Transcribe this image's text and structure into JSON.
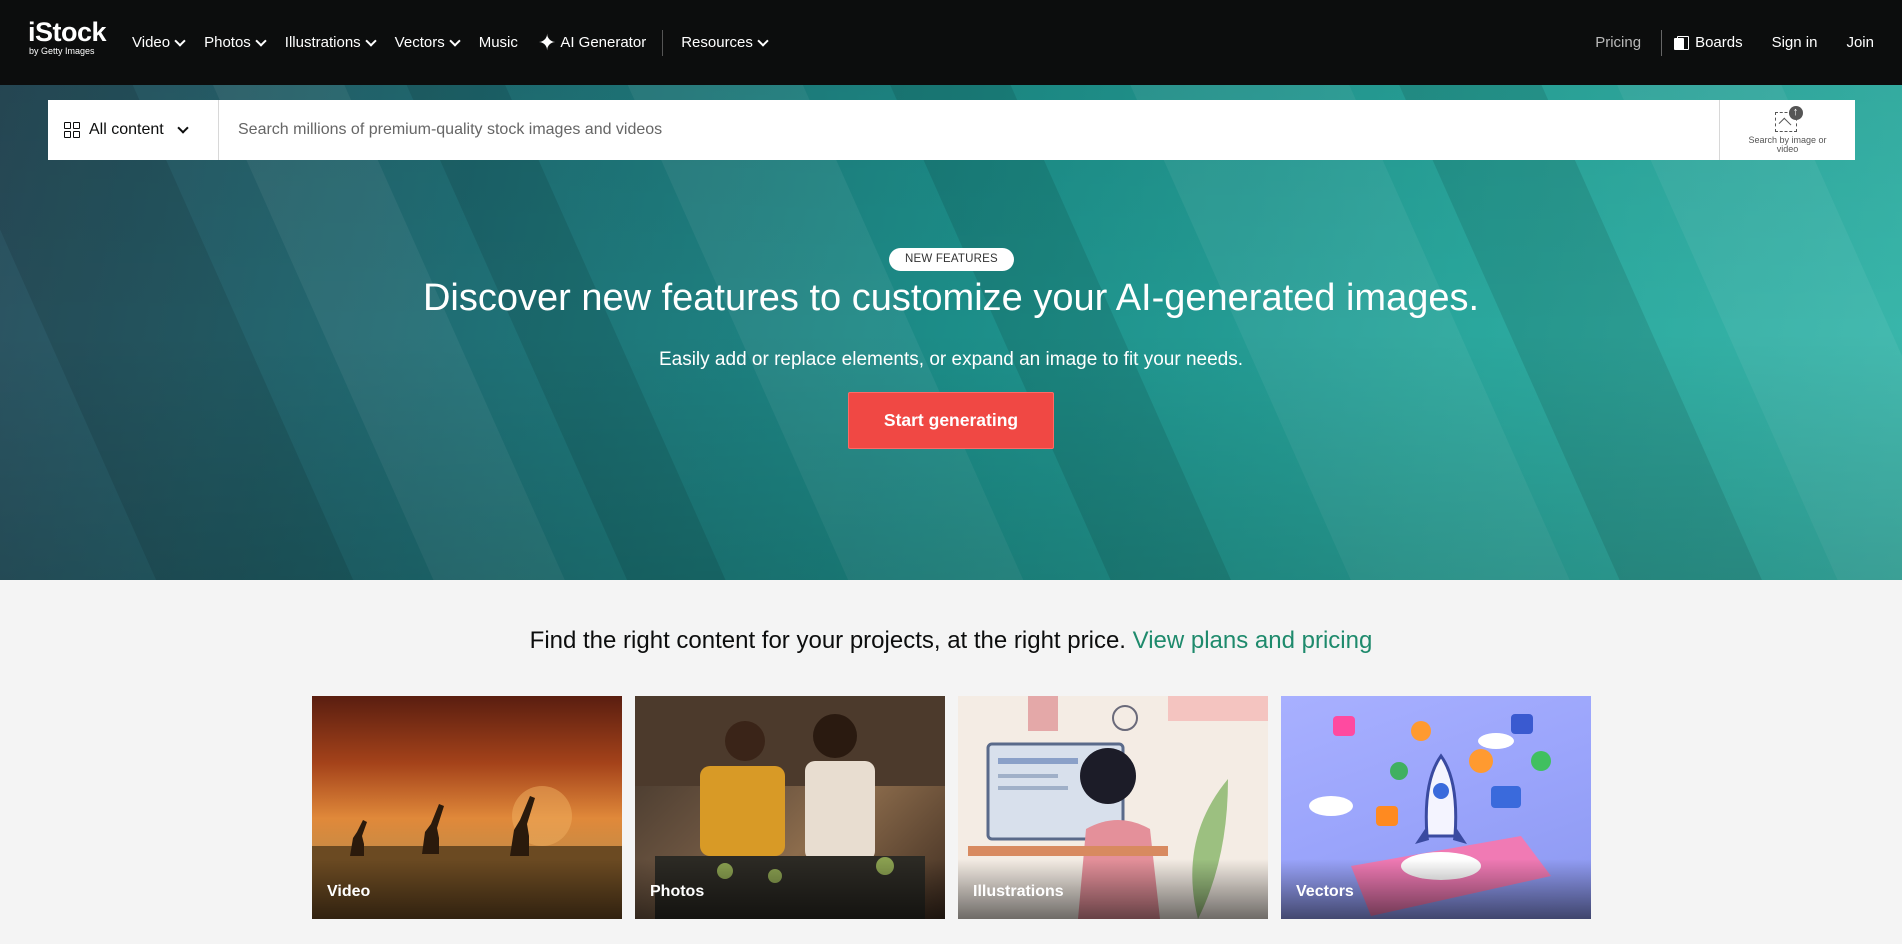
{
  "logo": {
    "name": "iStock",
    "tagline": "by Getty Images"
  },
  "nav": {
    "left_items": [
      {
        "label": "Video",
        "has_dropdown": true
      },
      {
        "label": "Photos",
        "has_dropdown": true
      },
      {
        "label": "Illustrations",
        "has_dropdown": true
      },
      {
        "label": "Vectors",
        "has_dropdown": true
      },
      {
        "label": "Music",
        "has_dropdown": false
      },
      {
        "label": "AI Generator",
        "icon": "sparkle-icon"
      },
      {
        "label": "Resources",
        "has_dropdown": true
      }
    ],
    "right_items": {
      "pricing": "Pricing",
      "boards": "Boards",
      "sign_in": "Sign in",
      "join": "Join"
    }
  },
  "search": {
    "content_type": "All content",
    "placeholder": "Search millions of premium-quality stock images and videos",
    "by_image_label": "Search by image or video"
  },
  "hero": {
    "badge": "NEW FEATURES",
    "title": "Discover new features to customize your AI-generated images.",
    "subtitle": "Easily add or replace elements, or expand an image to fit your needs.",
    "cta": "Start generating"
  },
  "section": {
    "tagline": "Find the right content for your projects, at the right price.",
    "tagline_link": "View plans and pricing"
  },
  "cards": [
    {
      "label": "Video"
    },
    {
      "label": "Photos"
    },
    {
      "label": "Illustrations"
    },
    {
      "label": "Vectors"
    }
  ],
  "colors": {
    "nav_bg": "#0c0d0d",
    "cta_bg": "#f04844",
    "link": "#1e8a6c",
    "page_bg": "#f4f4f4"
  }
}
